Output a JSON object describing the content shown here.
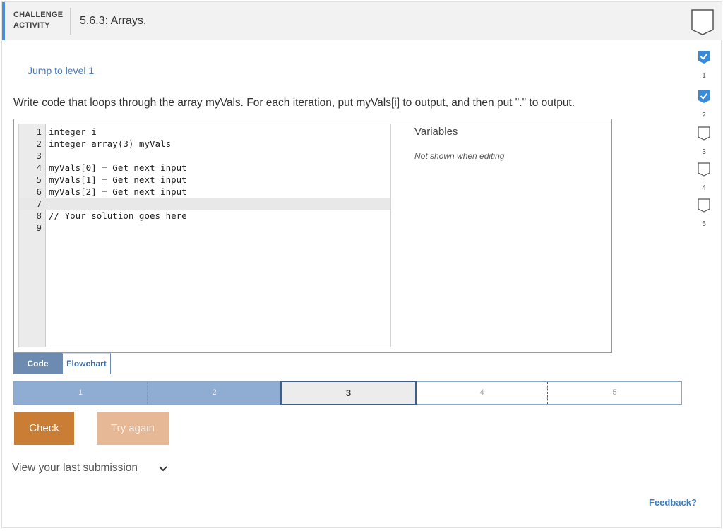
{
  "header": {
    "tag_line1": "CHALLENGE",
    "tag_line2": "ACTIVITY",
    "title": "5.6.3: Arrays.",
    "bookmark_icon": "bookmark-icon"
  },
  "levels_sidebar": [
    {
      "number": "1",
      "completed": true
    },
    {
      "number": "2",
      "completed": true
    },
    {
      "number": "3",
      "completed": false
    },
    {
      "number": "4",
      "completed": false
    },
    {
      "number": "5",
      "completed": false
    }
  ],
  "jump_link": "Jump to level 1",
  "instructions": "Write code that loops through the array myVals. For each iteration, put myVals[i] to output, and then put \".\" to output.",
  "editor": {
    "lines": [
      {
        "n": "1",
        "code": "integer i"
      },
      {
        "n": "2",
        "code": "integer array(3) myVals"
      },
      {
        "n": "3",
        "code": ""
      },
      {
        "n": "4",
        "code": "myVals[0] = Get next input"
      },
      {
        "n": "5",
        "code": "myVals[1] = Get next input"
      },
      {
        "n": "6",
        "code": "myVals[2] = Get next input"
      },
      {
        "n": "7",
        "code": ""
      },
      {
        "n": "8",
        "code": "// Your solution goes here"
      },
      {
        "n": "9",
        "code": ""
      }
    ],
    "active_line": "7"
  },
  "variables": {
    "title": "Variables",
    "note": "Not shown when editing"
  },
  "tabs": {
    "code": "Code",
    "flowchart": "Flowchart",
    "selected": "Code"
  },
  "level_bar": [
    {
      "label": "1",
      "state": "done"
    },
    {
      "label": "2",
      "state": "done"
    },
    {
      "label": "3",
      "state": "current"
    },
    {
      "label": "4",
      "state": "todo"
    },
    {
      "label": "5",
      "state": "todo"
    }
  ],
  "buttons": {
    "check": "Check",
    "try_again": "Try again"
  },
  "last_submission": "View your last submission",
  "feedback": "Feedback?",
  "colors": {
    "accent": "#4a90d9",
    "check_button": "#c97d35",
    "retry_button": "#e6b895",
    "level_done": "#8fadd3",
    "checkbox_done": "#3a8ad6"
  }
}
